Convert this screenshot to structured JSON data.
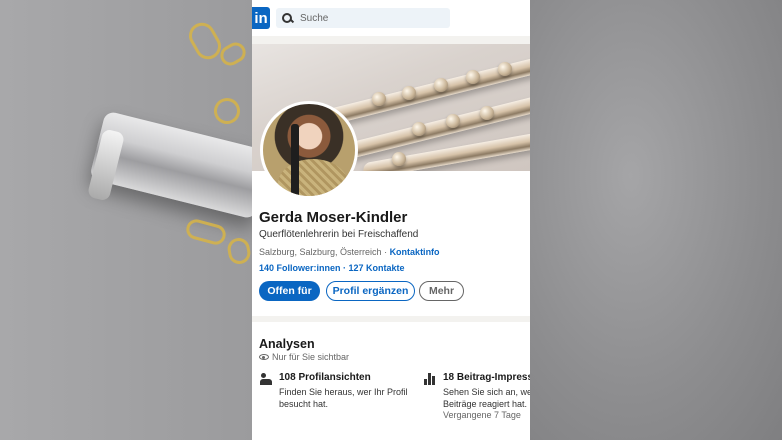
{
  "header": {
    "logo_text": "in",
    "search_placeholder": "Suche"
  },
  "profile": {
    "name": "Gerda Moser-Kindler",
    "headline": "Querflötenlehrerin bei Freischaffend",
    "location": "Salzburg, Salzburg, Österreich",
    "separator": " · ",
    "contact_info": "Kontaktinfo",
    "followers": "140 Follower:innen",
    "stats_separator": " · ",
    "connections": "127 Kontakte"
  },
  "actions": {
    "open_for": "Offen für",
    "add_profile": "Profil ergänzen",
    "more": "Mehr"
  },
  "analytics": {
    "title": "Analysen",
    "visibility": "Nur für Sie sichtbar",
    "metrics": [
      {
        "icon": "people-icon",
        "title": "108 Profilansichten",
        "desc_line1": "Finden Sie heraus, wer Ihr Profil",
        "desc_line2": "besucht hat."
      },
      {
        "icon": "bar-chart-icon",
        "title": "18 Beitrag-Impressi",
        "desc_line1": "Sehen Sie sich an, wer",
        "desc_line2": "Beiträge reagiert hat.",
        "timeframe": "Vergangene 7 Tage"
      }
    ]
  },
  "colors": {
    "brand": "#0a66c2",
    "page_bg": "#f3f2ef"
  }
}
